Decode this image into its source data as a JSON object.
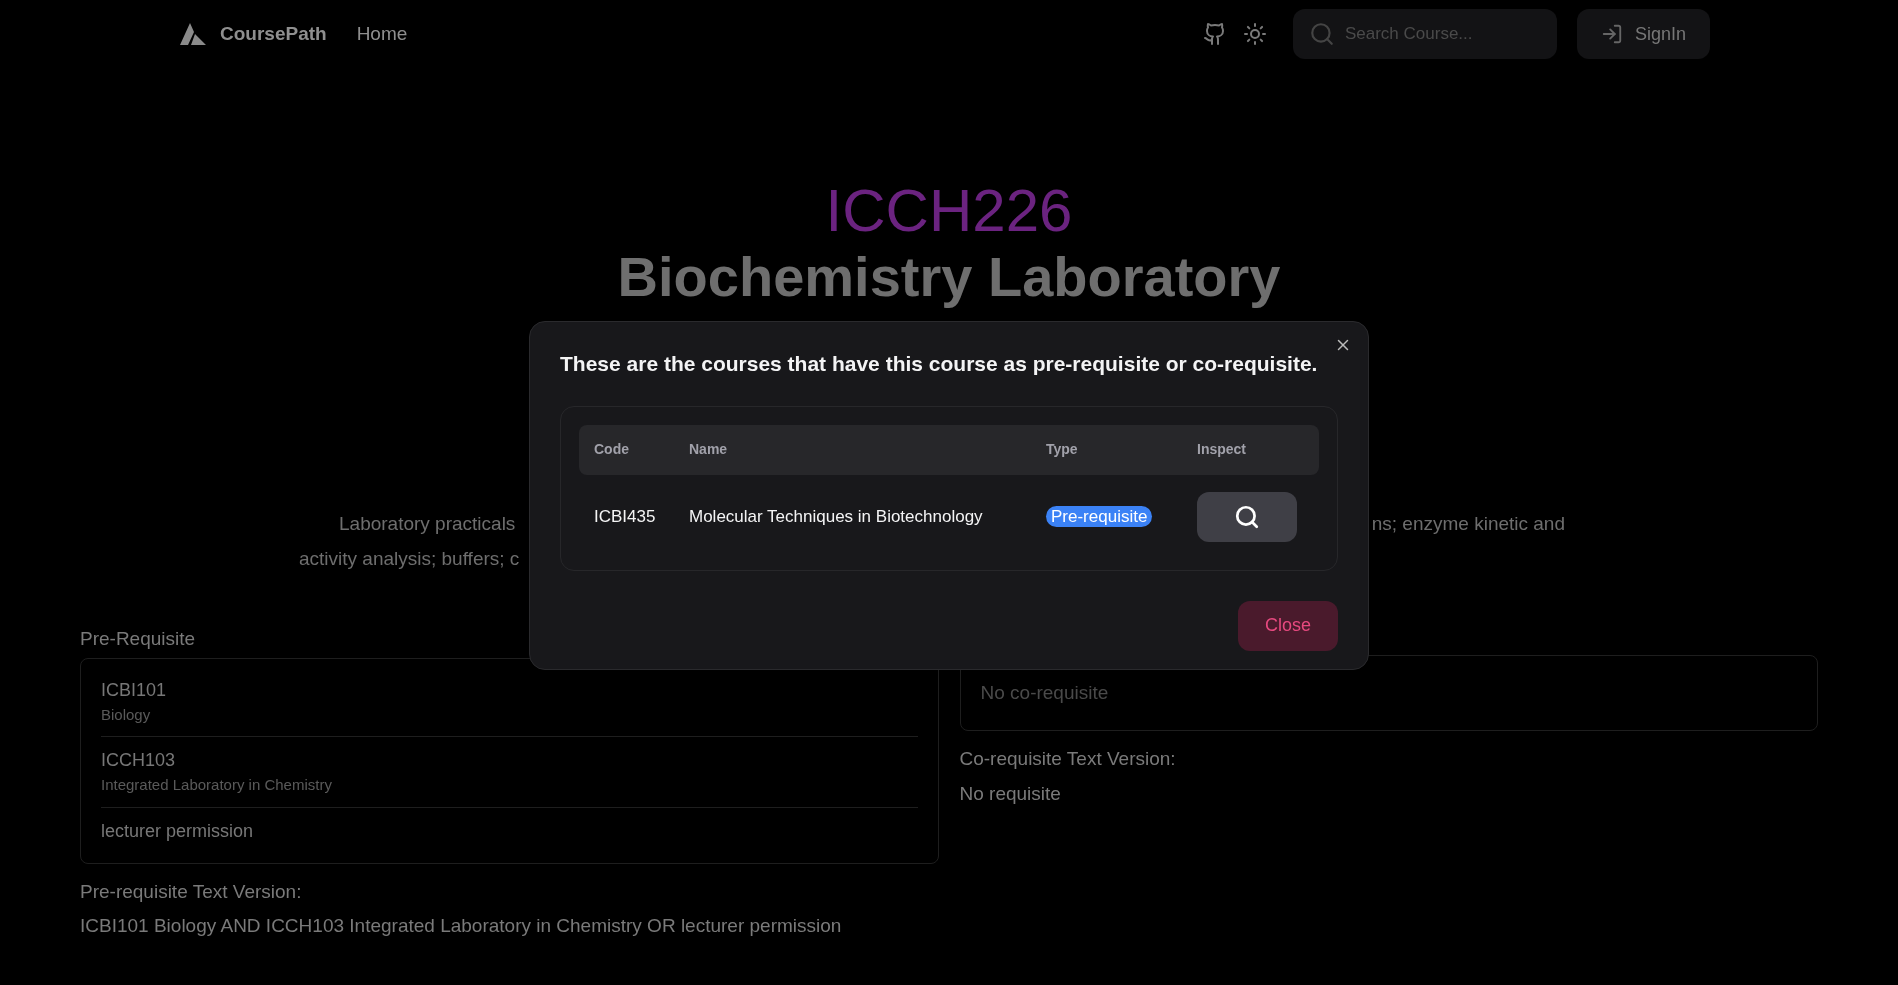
{
  "nav": {
    "brand": "CoursePath",
    "links": [
      {
        "label": "Home"
      }
    ],
    "search": {
      "placeholder": "Search Course..."
    },
    "signin": "SignIn"
  },
  "course": {
    "code": "ICCH226",
    "title": "Biochemistry Laboratory",
    "description_lines": [
      {
        "left": "Laboratory practicals",
        "right": "ns; enzyme kinetic and"
      },
      {
        "left": "activity analysis; buffers; c"
      }
    ]
  },
  "prerequisite": {
    "label": "Pre-Requisite",
    "items": [
      {
        "code": "ICBI101",
        "name": "Biology"
      },
      {
        "code": "ICCH103",
        "name": "Integrated Laboratory in Chemistry"
      },
      {
        "code": "lecturer permission"
      }
    ],
    "text_label": "Pre-requisite Text Version:",
    "text": "ICBI101 Biology AND ICCH103 Integrated Laboratory in Chemistry OR lecturer permission"
  },
  "corequisite": {
    "empty": "No co-requisite",
    "text_label": "Co-requisite Text Version:",
    "text": "No requisite"
  },
  "modal": {
    "title": "These are the courses that have this course as pre-requisite or co-requisite.",
    "columns": [
      "Code",
      "Name",
      "Type",
      "Inspect"
    ],
    "rows": [
      {
        "code": "ICBI435",
        "name": "Molecular Techniques in Biotechnology",
        "type": "Pre-requisite",
        "kind": "pre"
      }
    ],
    "close": "Close"
  }
}
